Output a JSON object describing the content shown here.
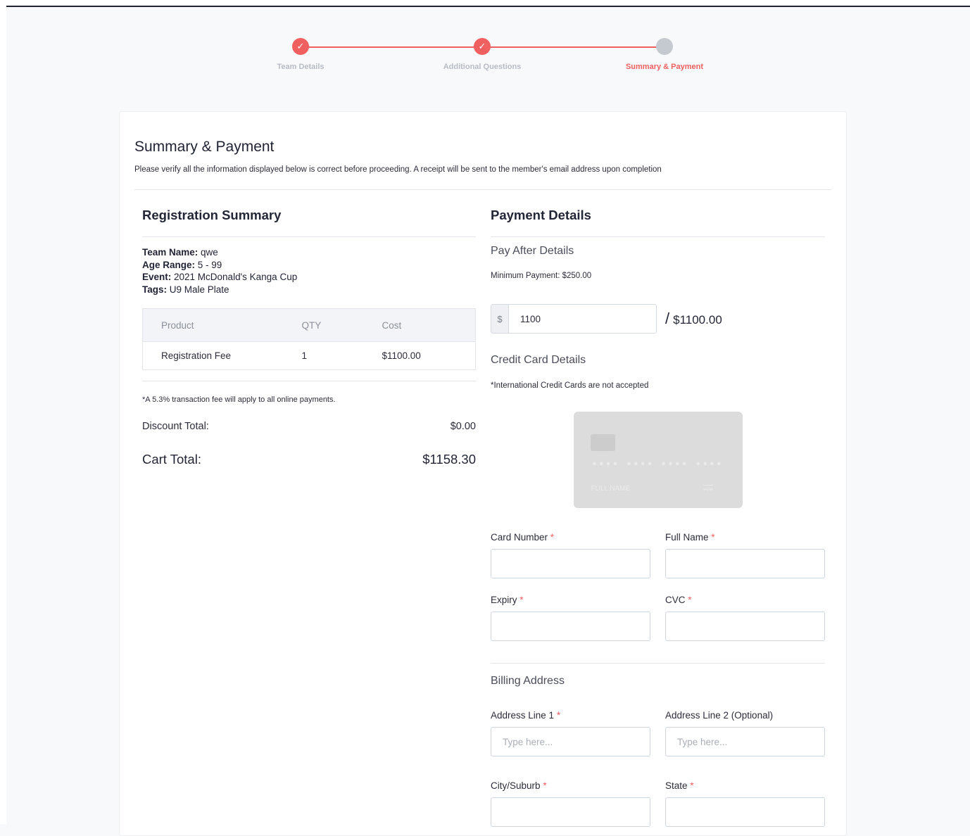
{
  "stepper": {
    "steps": [
      {
        "label": "Team Details",
        "state": "done"
      },
      {
        "label": "Additional Questions",
        "state": "done"
      },
      {
        "label": "Summary & Payment",
        "state": "active"
      }
    ],
    "check_glyph": "✓"
  },
  "page": {
    "title": "Summary & Payment",
    "description": "Please verify all the information displayed below is correct before proceeding. A receipt will be sent to the member's email address upon completion"
  },
  "summary": {
    "title": "Registration Summary",
    "team_label": "Team Name:",
    "team_value": " qwe",
    "age_label": "Age Range:",
    "age_value": " 5 - 99",
    "event_label": "Event:",
    "event_value": " 2021 McDonald's Kanga Cup",
    "tags_label": "Tags:",
    "tags_value": " U9 Male Plate",
    "table": {
      "headers": [
        "Product",
        "QTY",
        "Cost"
      ],
      "rows": [
        [
          "Registration Fee",
          "1",
          "$1100.00"
        ]
      ]
    },
    "fee_note": "*A 5.3% transaction fee will apply to all online payments.",
    "discount_label": "Discount Total:",
    "discount_value": "$0.00",
    "cart_label": "Cart Total:",
    "cart_value": "$1158.30"
  },
  "payment": {
    "title": "Payment Details",
    "pay_after_title": "Pay After Details",
    "minimum": "Minimum Payment: $250.00",
    "currency_symbol": "$",
    "amount_value": "1100",
    "slash": "/",
    "amount_total": "$1100.00",
    "cc_title": "Credit Card Details",
    "cc_note": "*International Credit Cards are not accepted",
    "card_preview": {
      "number": "•••• •••• •••• ••••",
      "name": "FULL NAME",
      "expiry": "••/••"
    },
    "fields": {
      "card_number": {
        "label": "Card Number",
        "value": ""
      },
      "full_name": {
        "label": "Full Name",
        "value": ""
      },
      "expiry": {
        "label": "Expiry",
        "value": ""
      },
      "cvc": {
        "label": "CVC",
        "value": ""
      }
    },
    "billing_title": "Billing Address",
    "billing": {
      "address1": {
        "label": "Address Line 1",
        "placeholder": "Type here..."
      },
      "address2": {
        "label": "Address Line 2 (Optional)",
        "placeholder": "Type here..."
      },
      "city": {
        "label": "City/Suburb"
      },
      "state": {
        "label": "State"
      }
    },
    "required_mark": "*"
  },
  "colors": {
    "accent": "#f06060",
    "pending": "#c5c9d0",
    "muted_label": "#b7bcc5"
  }
}
